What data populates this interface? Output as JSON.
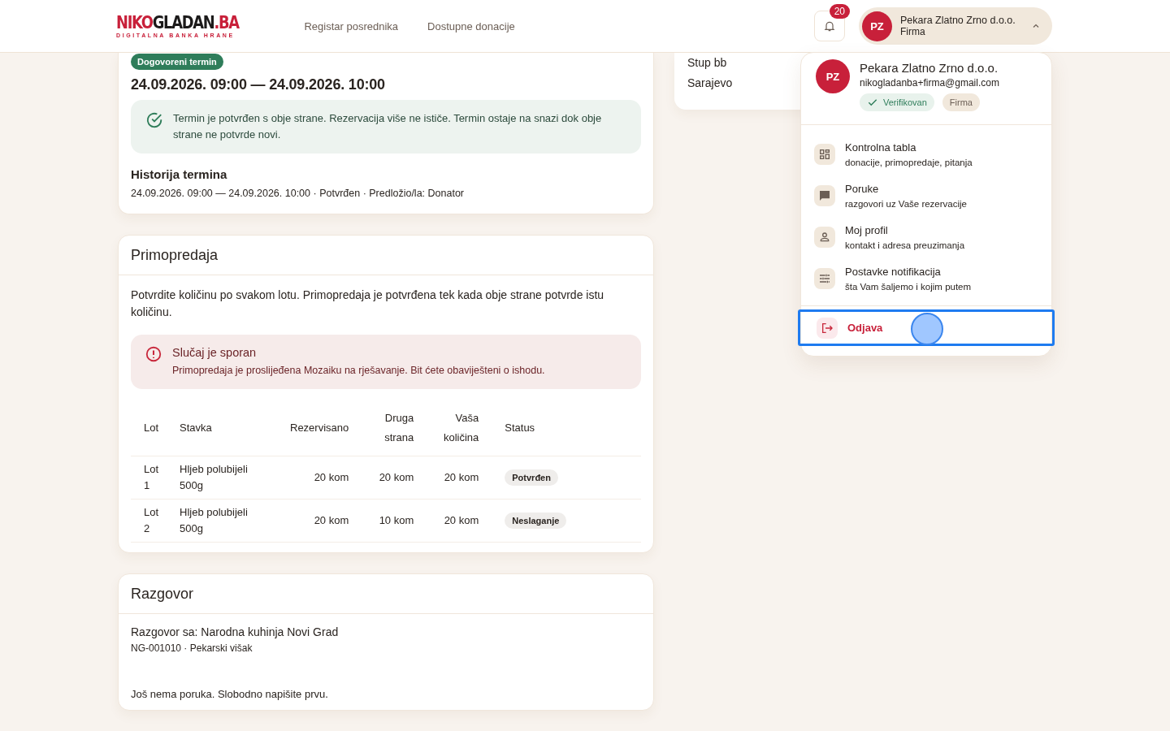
{
  "header": {
    "logo": {
      "title_parts": [
        "NIKO",
        "GLADAN",
        ".BA"
      ],
      "tagline": "DIGITALNA BANKA HRANE"
    },
    "nav": [
      "Registar posrednika",
      "Dostupne donacije"
    ],
    "notifications": {
      "count": "20"
    },
    "user": {
      "initials": "PZ",
      "name": "Pekara Zlatno Zrno d.o.o.",
      "role": "Firma",
      "expanded": true
    }
  },
  "appointment": {
    "badge": "Dogovoreni termin",
    "range": "24.09.2026. 09:00 — 24.09.2026. 10:00",
    "notice": "Termin je potvrđen s obje strane. Rezervacija više ne ističe. Termin ostaje na snazi dok obje strane ne potvrde novi.",
    "history_title": "Historija termina",
    "history": [
      "24.09.2026. 09:00 — 24.09.2026. 10:00 · Potvrđen · Predložio/la: Donator"
    ]
  },
  "address": {
    "lines": [
      "Stup bb",
      "Sarajevo"
    ]
  },
  "handover": {
    "title": "Primopredaja",
    "intro": "Potvrdite količinu po svakom lotu. Primopredaja je potvrđena tek kada obje strane potvrde istu količinu.",
    "alert": {
      "title": "Slučaj je sporan",
      "text": "Primopredaja je proslijeđena Mozaiku na rješavanje. Bit ćete obaviješteni o ishodu."
    },
    "table": {
      "columns": [
        {
          "label": "Lot",
          "kind": "text"
        },
        {
          "label": "Stavka",
          "kind": "text"
        },
        {
          "label": "Rezervisano",
          "kind": "number"
        },
        {
          "label": "Druga strana",
          "kind": "number"
        },
        {
          "label": "Vaša količina",
          "kind": "number"
        },
        {
          "label": "Status",
          "kind": "text"
        }
      ],
      "rows": [
        {
          "cells": [
            "Lot 1",
            "Hljeb polubijeli 500g",
            "20 kom",
            "20 kom",
            "20 kom"
          ],
          "status": "Potvrđen"
        },
        {
          "cells": [
            "Lot 2",
            "Hljeb polubijeli 500g",
            "20 kom",
            "10 kom",
            "20 kom"
          ],
          "status": "Neslaganje"
        }
      ]
    }
  },
  "conversation": {
    "title": "Razgovor",
    "with": "Razgovor sa: Narodna kuhinja Novi Grad",
    "meta": "NG-001010 · Pekarski višak",
    "empty": "Još nema poruka. Slobodno napišite prvu."
  },
  "menu": {
    "initials": "PZ",
    "name": "Pekara Zlatno Zrno d.o.o.",
    "email": "nikogladanba+firma@gmail.com",
    "tags": [
      {
        "kind": "verified",
        "label": "Verifikovan"
      },
      {
        "kind": "plain",
        "label": "Firma"
      }
    ],
    "items": [
      {
        "kind": "grid",
        "title": "Kontrolna tabla",
        "subtitle": "donacije, primopredaje, pitanja"
      },
      {
        "kind": "chat",
        "title": "Poruke",
        "subtitle": "razgovori uz Vaše rezervacije"
      },
      {
        "kind": "person",
        "title": "Moj profil",
        "subtitle": "kontakt i adresa preuzimanja"
      },
      {
        "kind": "sliders",
        "title": "Postavke notifikacija",
        "subtitle": "šta Vam šaljemo i kojim putem"
      }
    ],
    "logout": {
      "label": "Odjava",
      "focused": true
    }
  }
}
